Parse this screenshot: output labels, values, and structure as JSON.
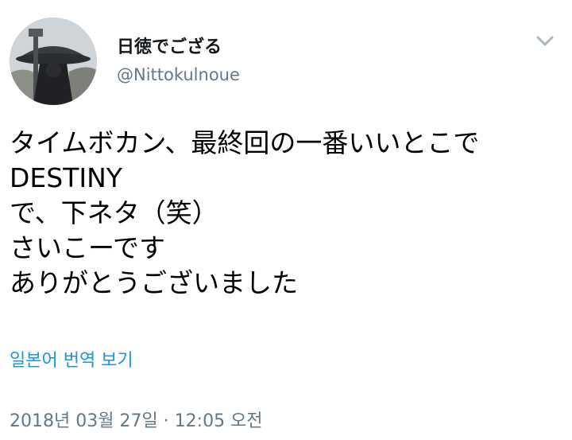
{
  "author": {
    "display_name": "日徳でござる",
    "handle": "@Nittokulnoue",
    "avatar_icon": "avatar-photo-icon"
  },
  "menu": {
    "icon": "chevron-down-icon",
    "color": "#aab8c2"
  },
  "tweet": {
    "lines": [
      "タイムボカン、最終回の一番いいとこで",
      "DESTINY",
      "で、下ネタ（笑）",
      "さいこーです",
      "ありがとうございました"
    ]
  },
  "translate": {
    "label": "일본어 번역 보기",
    "color": "#1b95e0"
  },
  "timestamp": "2018년 03월 27일 · 12:05 오전"
}
